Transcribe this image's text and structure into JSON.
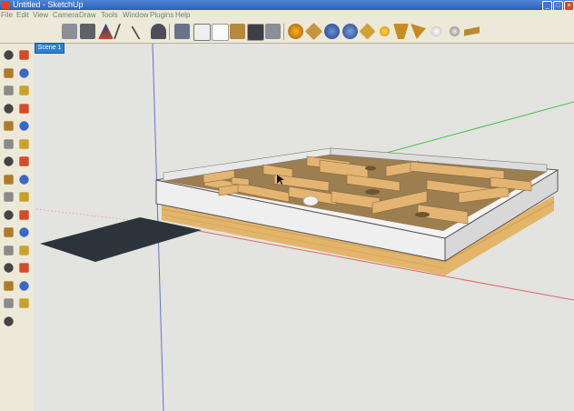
{
  "window": {
    "title": "Untitled - SketchUp"
  },
  "menu": [
    "File",
    "Edit",
    "View",
    "Camera",
    "Draw",
    "Tools",
    "Window",
    "Plugins",
    "Help"
  ],
  "scene_tab": "Scene 1",
  "toolbar_icons": [
    "new-document-icon",
    "open-icon",
    "axes-icon",
    "line-tool-icon",
    "pencil-icon",
    "walkthrough-icon",
    "standard-view-iso-icon",
    "x-ray-icon",
    "wireframe-icon",
    "hidden-line-icon",
    "shaded-icon",
    "shaded-textures-icon",
    "monochrome-icon",
    "components-icon",
    "materials-icon",
    "styles-icon",
    "layers-icon",
    "tags-icon",
    "sun-icon",
    "shadows-icon",
    "fog-icon",
    "lights-icon",
    "sphere-icon",
    "dimension-icon"
  ],
  "left_tools": [
    "select-icon",
    "eraser-icon",
    "paint-icon",
    "rectangle-icon",
    "line-icon",
    "circle-icon",
    "arc-icon",
    "polygon-icon",
    "freehand-icon",
    "move-icon",
    "push-pull-icon",
    "rotate-icon",
    "follow-me-icon",
    "scale-icon",
    "offset-icon",
    "tape-measure-icon",
    "dimension-icon",
    "protractor-icon",
    "text-icon",
    "axes-icon",
    "3d-text-icon",
    "orbit-icon",
    "pan-icon",
    "zoom-icon",
    "zoom-window-icon",
    "zoom-extents-icon",
    "previous-icon",
    "position-camera-icon",
    "look-around-icon",
    "walk-icon",
    "section-plane-icon"
  ]
}
